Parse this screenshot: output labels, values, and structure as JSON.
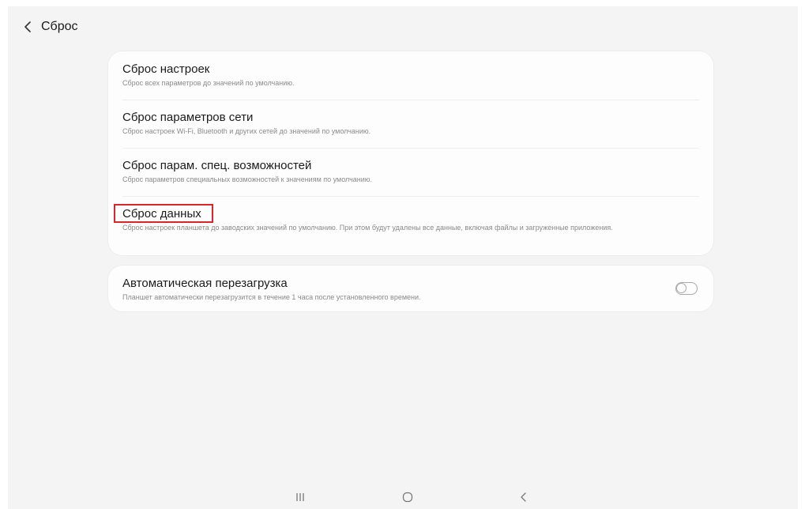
{
  "header": {
    "back_icon": "chevron-left-icon",
    "title": "Сброс"
  },
  "reset_items": [
    {
      "title": "Сброс настроек",
      "description": "Сброс всех параметров до значений по умолчанию."
    },
    {
      "title": "Сброс параметров сети",
      "description": "Сброс настроек Wi-Fi, Bluetooth и других сетей до значений по умолчанию."
    },
    {
      "title": "Сброс парам. спец. возможностей",
      "description": "Сброс параметров специальных возможностей к значениям по умолчанию."
    },
    {
      "title": "Сброс данных",
      "description": "Сброс настроек планшета до заводских значений по умолчанию. При этом будут удалены все данные, включая файлы и загруженные приложения."
    }
  ],
  "auto_restart": {
    "title": "Автоматическая перезагрузка",
    "description": "Планшет автоматически перезагрузится в течение 1 часа после установленного времени.",
    "enabled": false
  },
  "highlight": {
    "target": "Сброс данных",
    "color": "#d9262d"
  },
  "nav_bar": {
    "icons": [
      "recents-icon",
      "home-icon",
      "back-icon"
    ]
  },
  "colors": {
    "background": "#f4f4f4",
    "card": "#fdfdfd",
    "secondary_text": "#8a8a8a"
  }
}
